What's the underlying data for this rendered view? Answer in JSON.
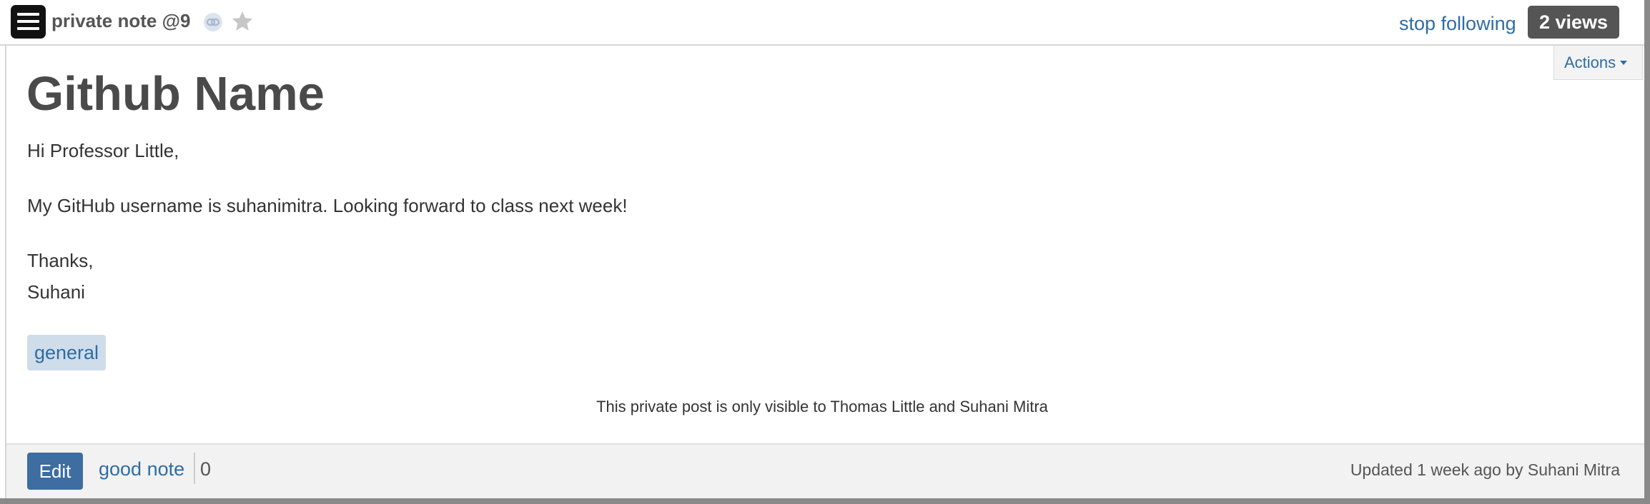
{
  "header": {
    "note_title": "private note @9",
    "stop_following": "stop following",
    "views": "2 views",
    "icons": {
      "menu": "hamburger-menu-icon",
      "link": "link-icon",
      "star": "star-icon"
    }
  },
  "actions": {
    "label": "Actions",
    "icon": "caret-down-icon"
  },
  "post": {
    "title": "Github Name",
    "lines": [
      "Hi Professor Little,",
      "My GitHub username is suhanimitra. Looking forward to class next week!",
      "Thanks,",
      "Suhani"
    ],
    "tag": "general",
    "visibility": "This private post is only visible to Thomas Little and Suhani Mitra"
  },
  "footer": {
    "edit": "Edit",
    "good_note": "good note",
    "good_count": "0",
    "updated": "Updated 1 week ago by Suhani Mitra"
  },
  "colors": {
    "link": "#2e6da4",
    "edit_button": "#3d6da1",
    "badge": "#555555",
    "tag_bg": "#cfdcea",
    "footer_bg": "#f2f2f2"
  }
}
